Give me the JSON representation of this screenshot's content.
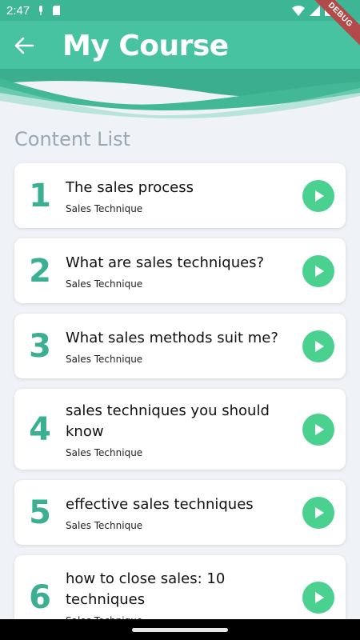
{
  "status_bar": {
    "time": "2:47"
  },
  "debug_label": "DEBUG",
  "app_bar": {
    "title": "My Course"
  },
  "content": {
    "section_title": "Content List",
    "items": [
      {
        "number": "1",
        "title": "The sales process",
        "subtitle": "Sales Technique"
      },
      {
        "number": "2",
        "title": "What are sales techniques?",
        "subtitle": "Sales Technique"
      },
      {
        "number": "3",
        "title": "What sales methods suit me?",
        "subtitle": "Sales Technique"
      },
      {
        "number": "4",
        "title": "sales techniques you should know",
        "subtitle": "Sales Technique"
      },
      {
        "number": "5",
        "title": "effective sales techniques",
        "subtitle": "Sales Technique"
      },
      {
        "number": "6",
        "title": "how to close sales: 10 techniques",
        "subtitle": "Sales Technique"
      }
    ]
  },
  "colors": {
    "app_bar": "#47c3a2",
    "accent_number": "#3caf93",
    "play_button": "#4ad08f",
    "background": "#eff2f7"
  },
  "icons": {
    "back": "arrow-left-icon",
    "play": "play-circle-icon",
    "wifi": "wifi-icon",
    "signal": "signal-icon",
    "battery": "battery-icon"
  }
}
